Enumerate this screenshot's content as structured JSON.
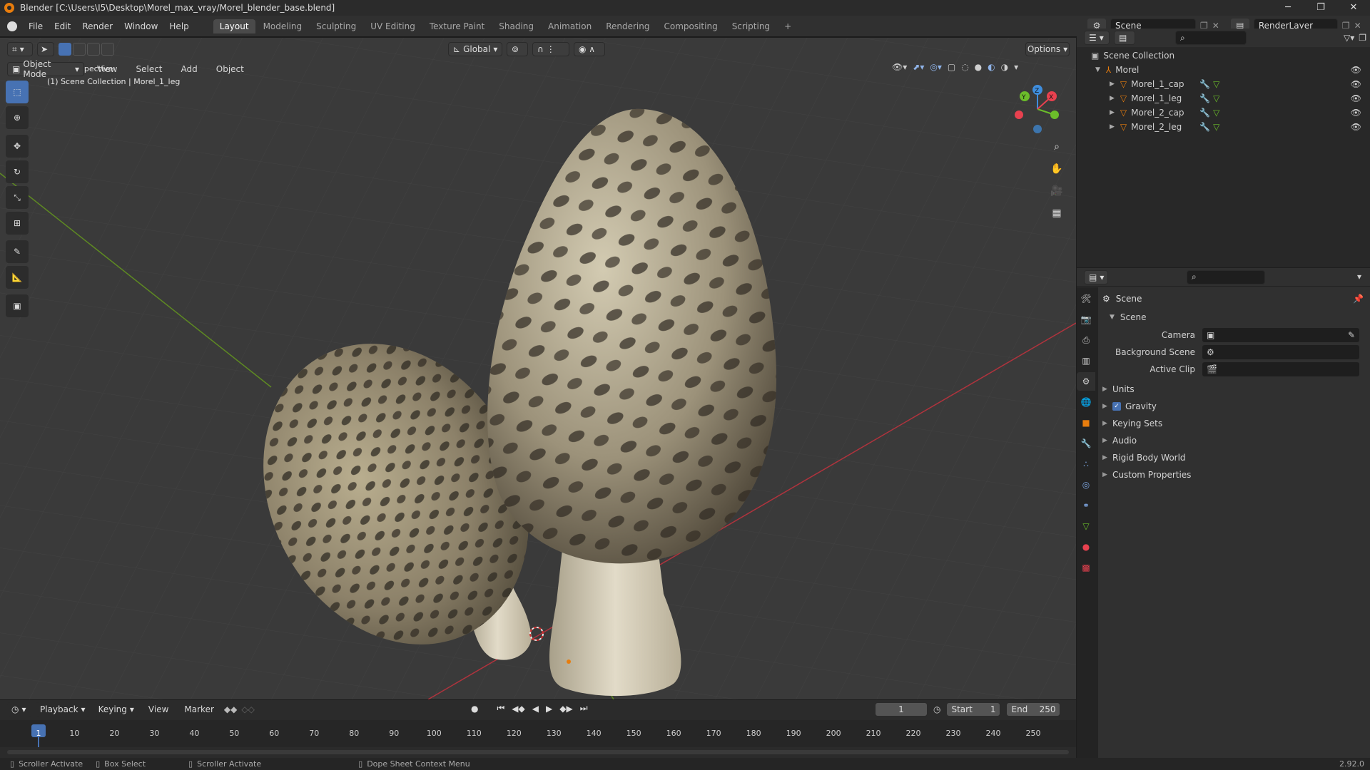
{
  "window": {
    "title": "Blender [C:\\Users\\I5\\Desktop\\Morel_max_vray/Morel_blender_base.blend]",
    "minimize": "─",
    "maximize": "❐",
    "close": "✕"
  },
  "menubar": {
    "menus": [
      "File",
      "Edit",
      "Render",
      "Window",
      "Help"
    ],
    "workspaces": [
      "Layout",
      "Modeling",
      "Sculpting",
      "UV Editing",
      "Texture Paint",
      "Shading",
      "Animation",
      "Rendering",
      "Compositing",
      "Scripting"
    ],
    "active_workspace": "Layout",
    "add_tab": "+",
    "scene_name": "Scene",
    "render_layer": "RenderLayer"
  },
  "viewport": {
    "mode": "Object Mode",
    "menus": [
      "View",
      "Select",
      "Add",
      "Object"
    ],
    "transform_orientation": "Global",
    "options_label": "Options",
    "overlay_line1": "User Perspective",
    "overlay_line2": "(1) Scene Collection | Morel_1_leg",
    "gizmo": {
      "x": "X",
      "y": "Y",
      "z": "Z"
    }
  },
  "outliner": {
    "root": "Scene Collection",
    "collection": "Morel",
    "objects": [
      "Morel_1_cap",
      "Morel_1_leg",
      "Morel_2_cap",
      "Morel_2_leg"
    ]
  },
  "properties": {
    "context_title": "Scene",
    "panel_title": "Scene",
    "fields": [
      {
        "label": "Camera",
        "value": ""
      },
      {
        "label": "Background Scene",
        "value": ""
      },
      {
        "label": "Active Clip",
        "value": ""
      }
    ],
    "sections": [
      "Units",
      "Gravity",
      "Keying Sets",
      "Audio",
      "Rigid Body World",
      "Custom Properties"
    ],
    "gravity_checked": true
  },
  "timeline": {
    "menus": [
      "Playback",
      "Keying",
      "View",
      "Marker"
    ],
    "current_frame": "1",
    "start_label": "Start",
    "start_value": "1",
    "end_label": "End",
    "end_value": "250",
    "ticks": [
      "1",
      "10",
      "20",
      "30",
      "40",
      "50",
      "60",
      "70",
      "80",
      "90",
      "100",
      "110",
      "120",
      "130",
      "140",
      "150",
      "160",
      "170",
      "180",
      "190",
      "200",
      "210",
      "220",
      "230",
      "240",
      "250"
    ]
  },
  "statusbar": {
    "items": [
      "Scroller Activate",
      "Box Select",
      "Scroller Activate",
      "Dope Sheet Context Menu"
    ],
    "version": "2.92.0"
  },
  "colors": {
    "accent_blue": "#4772b3",
    "active_orange": "#e87d0d",
    "axis_x": "#e8414f",
    "axis_y": "#6bbd2a",
    "axis_z": "#3f8ede"
  }
}
